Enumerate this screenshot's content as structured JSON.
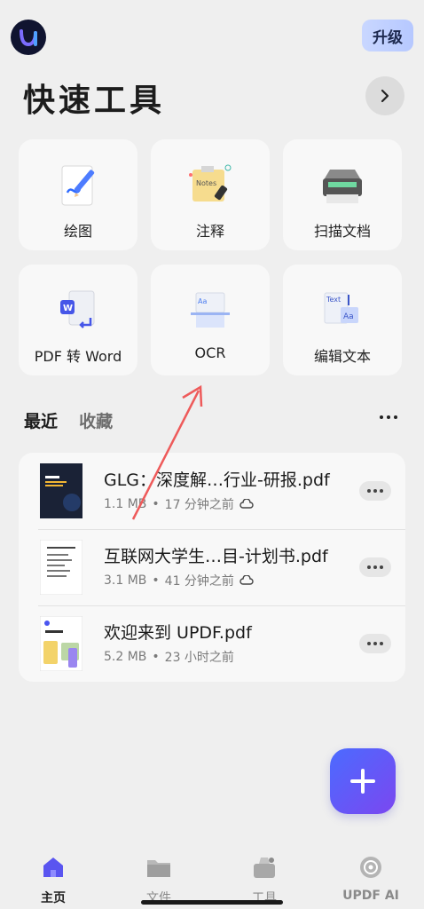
{
  "header": {
    "upgrade_label": "升级"
  },
  "quick_tools": {
    "title": "快速工具",
    "items": [
      {
        "label": "绘图",
        "icon": "drawing-icon"
      },
      {
        "label": "注释",
        "icon": "notes-icon"
      },
      {
        "label": "扫描文档",
        "icon": "scanner-icon"
      },
      {
        "label": "PDF 转 Word",
        "icon": "pdf-to-word-icon"
      },
      {
        "label": "OCR",
        "icon": "ocr-icon"
      },
      {
        "label": "编辑文本",
        "icon": "edit-text-icon"
      }
    ],
    "notes_sticker_text": "Notes",
    "edit_text_tag": "Text",
    "aa_glyph": "Aa"
  },
  "recent": {
    "tabs": [
      "最近",
      "收藏"
    ],
    "files": [
      {
        "name": "GLG：深度解…行业-研报.pdf",
        "size": "1.1 MB",
        "time": "17 分钟之前",
        "cloud": true
      },
      {
        "name": "互联网大学生…目-计划书.pdf",
        "size": "3.1 MB",
        "time": "41 分钟之前",
        "cloud": true
      },
      {
        "name": "欢迎来到 UPDF.pdf",
        "size": "5.2 MB",
        "time": "23 小时之前",
        "cloud": false
      }
    ]
  },
  "bottom_nav": {
    "items": [
      {
        "label": "主页",
        "active": true
      },
      {
        "label": "文件",
        "active": false
      },
      {
        "label": "工具",
        "active": false
      },
      {
        "label": "UPDF AI",
        "active": false
      }
    ]
  },
  "colors": {
    "accent": "#5a55f0",
    "background": "#efefef",
    "card": "#f8f8f8"
  }
}
